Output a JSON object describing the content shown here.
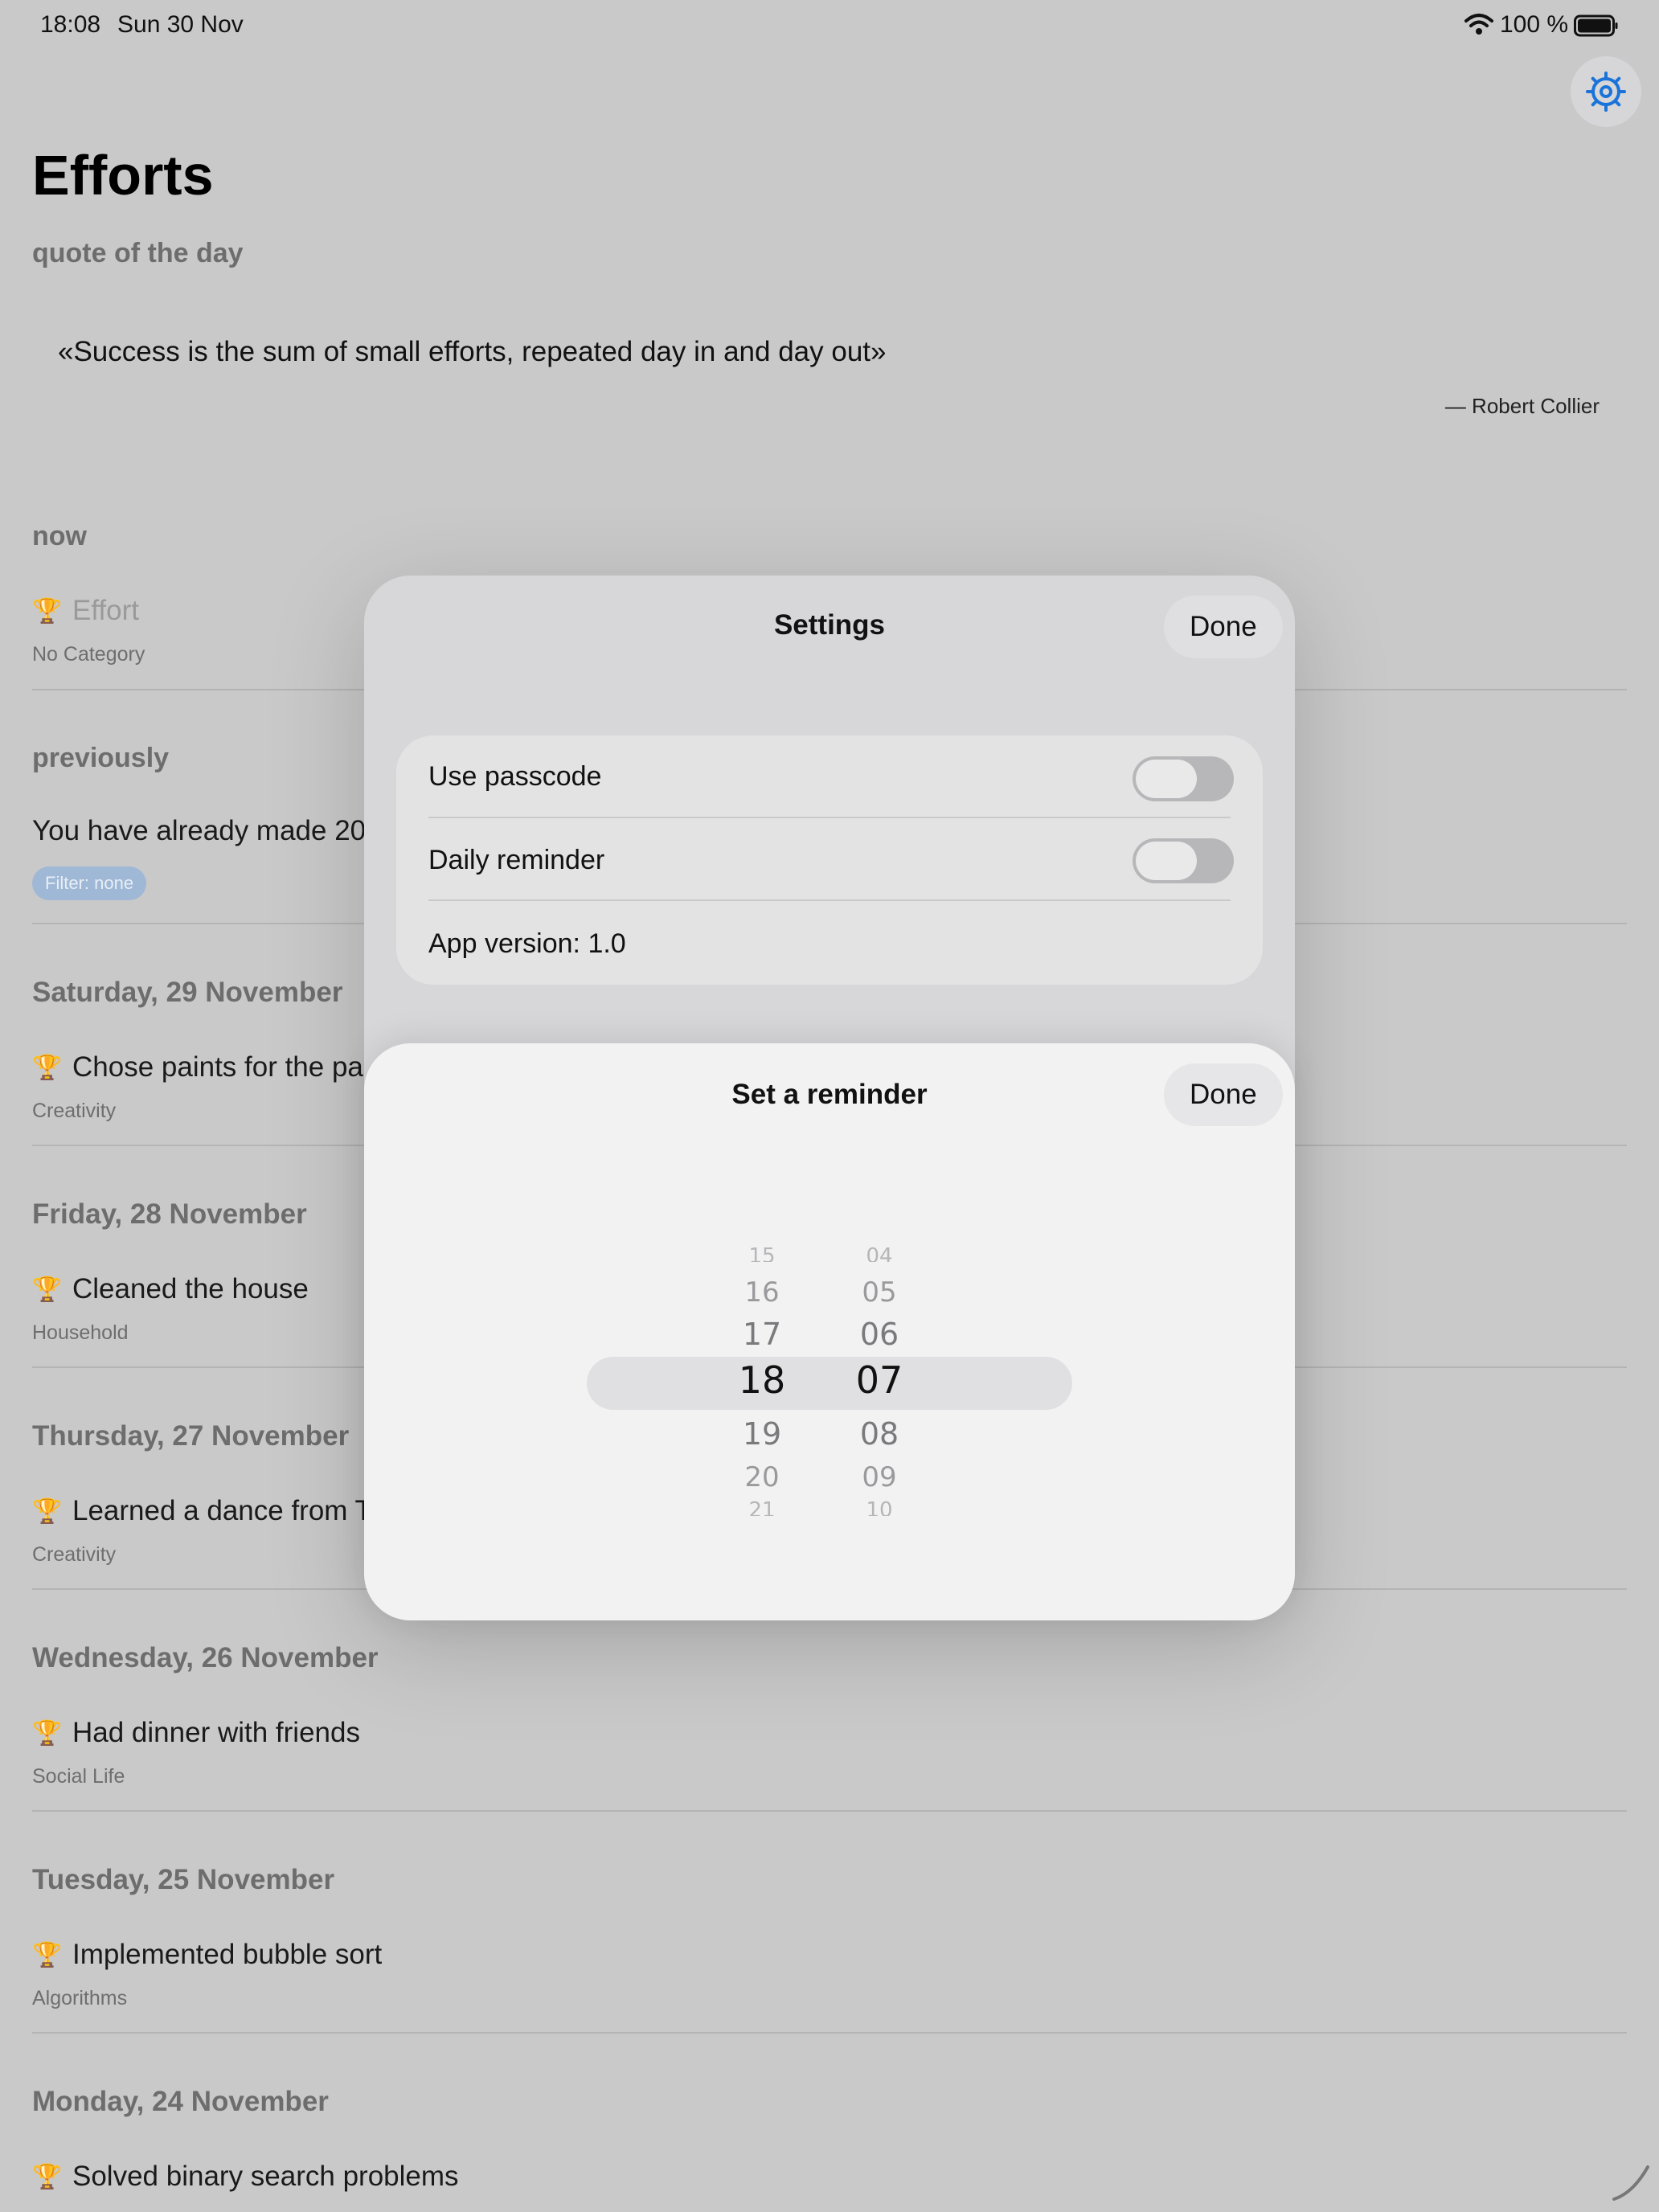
{
  "status_bar": {
    "time": "18:08",
    "date": "Sun 30 Nov",
    "battery": "100 %"
  },
  "app": {
    "title": "Efforts",
    "quote_section": "quote of the day",
    "quote": "«Success is the sum of small efforts, repeated day in and day out»",
    "quote_author": "— Robert Collier",
    "now_section": "now",
    "now_item": {
      "title": "Effort",
      "category": "No Category"
    },
    "previously_section": "previously",
    "previously_text": "You have already made 20 e",
    "filter_chip": "Filter: none",
    "days": [
      {
        "date": "Saturday, 29 November",
        "title": "Chose paints for the pai",
        "category": "Creativity"
      },
      {
        "date": "Friday, 28 November",
        "title": "Cleaned the house",
        "category": "Household"
      },
      {
        "date": "Thursday, 27 November",
        "title": "Learned a dance from T",
        "category": "Creativity"
      },
      {
        "date": "Wednesday, 26 November",
        "title": "Had dinner with friends",
        "category": "Social Life"
      },
      {
        "date": "Tuesday, 25 November",
        "title": "Implemented bubble sort",
        "category": "Algorithms"
      },
      {
        "date": "Monday, 24 November",
        "title": "Solved binary search problems",
        "category": ""
      }
    ]
  },
  "settings": {
    "title": "Settings",
    "done": "Done",
    "rows": {
      "passcode": {
        "label": "Use passcode",
        "on": false
      },
      "reminder": {
        "label": "Daily reminder",
        "on": false
      },
      "version": "App version: 1.0"
    }
  },
  "reminder_sheet": {
    "title": "Set a reminder",
    "done": "Done",
    "hours": [
      "15",
      "16",
      "17",
      "18",
      "19",
      "20",
      "21"
    ],
    "minutes": [
      "04",
      "05",
      "06",
      "07",
      "08",
      "09",
      "10"
    ],
    "selected_hour": "18",
    "selected_minute": "07"
  },
  "colors": {
    "accent": "#1a73d9",
    "background": "#c9c9c9"
  }
}
